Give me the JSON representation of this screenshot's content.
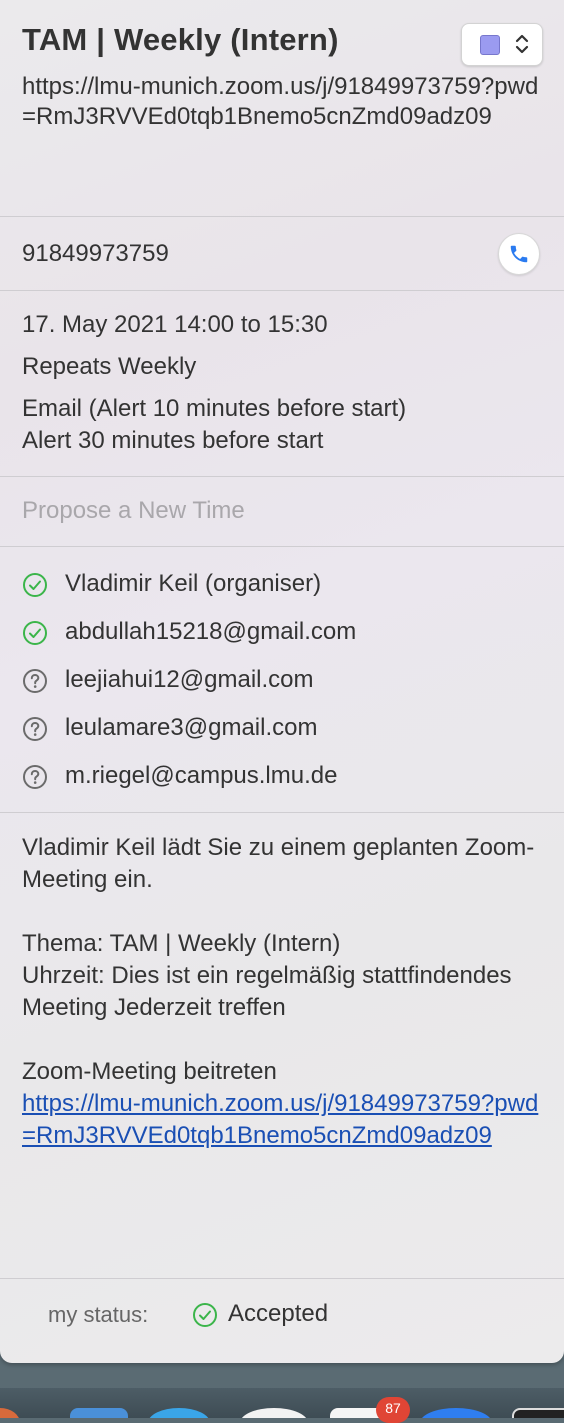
{
  "event": {
    "title": "TAM | Weekly (Intern)",
    "url": "https://lmu-munich.zoom.us/j/91849973759?pwd=RmJ3RVVEd0tqb1Bnemo5cnZmd09adz09",
    "calendar_color": "#9b9bf0"
  },
  "phone": {
    "number": "91849973759"
  },
  "schedule": {
    "date_time": "17. May 2021  14:00 to 15:30",
    "repeat": "Repeats Weekly",
    "alert_1": "Email (Alert 10 minutes before start)",
    "alert_2": "Alert 30 minutes before start"
  },
  "propose": {
    "label": "Propose a New Time"
  },
  "attendees": [
    {
      "name": "Vladimir Keil (organiser)",
      "status": "accepted"
    },
    {
      "name": "abdullah15218@gmail.com",
      "status": "accepted"
    },
    {
      "name": "leejiahui12@gmail.com",
      "status": "unknown"
    },
    {
      "name": "leulamare3@gmail.com",
      "status": "unknown"
    },
    {
      "name": "m.riegel@campus.lmu.de",
      "status": "unknown"
    }
  ],
  "notes": {
    "line_1": "Vladimir Keil lädt Sie zu einem geplanten Zoom-Meeting ein.",
    "line_2": "Thema: TAM | Weekly (Intern)",
    "line_3": "Uhrzeit: Dies ist ein regelmäßig stattfindendes Meeting Jederzeit treffen",
    "line_4": "Zoom-Meeting beitreten",
    "link": "https://lmu-munich.zoom.us/j/91849973759?pwd=RmJ3RVVEd0tqb1Bnemo5cnZmd09adz09"
  },
  "my_status": {
    "label": "my status:",
    "value": "Accepted"
  },
  "dock": {
    "badge_count": "87"
  },
  "colors": {
    "accepted_green": "#3bb54a",
    "unknown_gray": "#6b6b6b",
    "link_blue": "#1a4fb4",
    "phone_blue": "#2b7bf0"
  }
}
